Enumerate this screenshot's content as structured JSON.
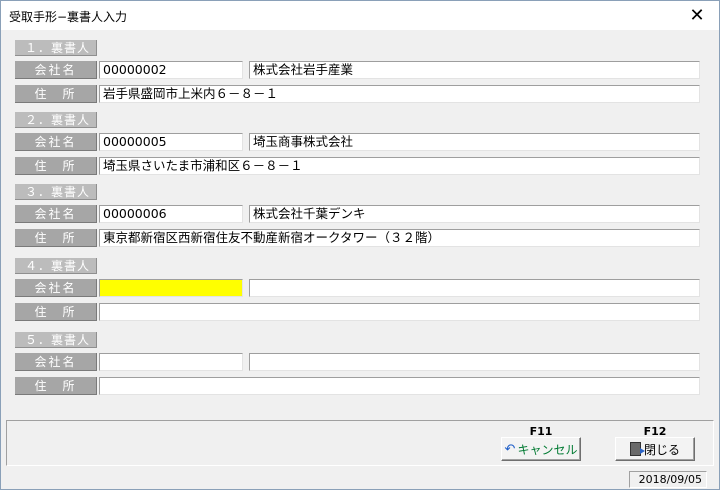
{
  "window": {
    "title": "受取手形−裏書人入力",
    "close_glyph": "✕"
  },
  "labels": {
    "company": "会社名",
    "address": "住　所"
  },
  "endorsers": [
    {
      "heading": "１．裏書人",
      "code": "00000002",
      "company": "株式会社岩手産業",
      "address": "岩手県盛岡市上米内６－８－１"
    },
    {
      "heading": "２．裏書人",
      "code": "00000005",
      "company": "埼玉商事株式会社",
      "address": "埼玉県さいたま市浦和区６－８－１"
    },
    {
      "heading": "３．裏書人",
      "code": "00000006",
      "company": "株式会社千葉デンキ",
      "address": "東京都新宿区西新宿住友不動産新宿オークタワー（３２階）"
    },
    {
      "heading": "４．裏書人",
      "code": "",
      "company": "",
      "address": ""
    },
    {
      "heading": "５．裏書人",
      "code": "",
      "company": "",
      "address": ""
    }
  ],
  "buttons": {
    "cancel": {
      "key": "F11",
      "label": "キャンセル",
      "icon": "undo-icon"
    },
    "close": {
      "key": "F12",
      "label": "閉じる",
      "icon": "exit-door-icon"
    }
  },
  "status": {
    "date": "2018/09/05"
  }
}
